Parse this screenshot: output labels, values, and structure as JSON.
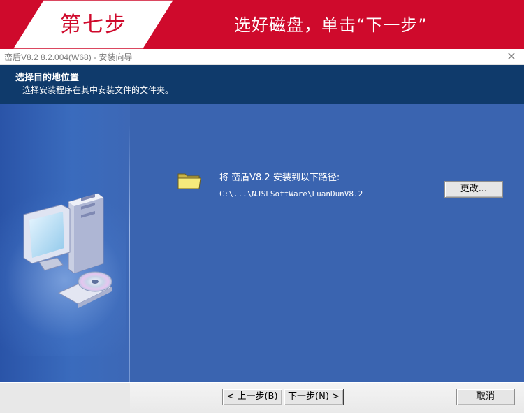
{
  "banner": {
    "step": "第七步",
    "instruction": "选好磁盘，单击“下一步”",
    "accent_color": "#cf0a2c"
  },
  "window": {
    "title": "峦盾V8.2 8.2.004(W68) - 安装向导",
    "close_icon": "close-icon"
  },
  "header": {
    "title": "选择目的地位置",
    "subtitle": "选择安装程序在其中安装文件的文件夹。",
    "background": "#0f3a6b"
  },
  "content": {
    "background": "#3a64b0",
    "install_label": "将 峦盾V8.2 安装到以下路径:",
    "install_path": "C:\\...\\NJSLSoftWare\\LuanDunV8.2",
    "folder_icon": "folder-icon",
    "side_image_icon": "computer-setup-icon",
    "change_button": "更改..."
  },
  "footer": {
    "back_button": "< 上一步(B)",
    "next_button": "下一步(N) >",
    "cancel_button": "取消"
  }
}
